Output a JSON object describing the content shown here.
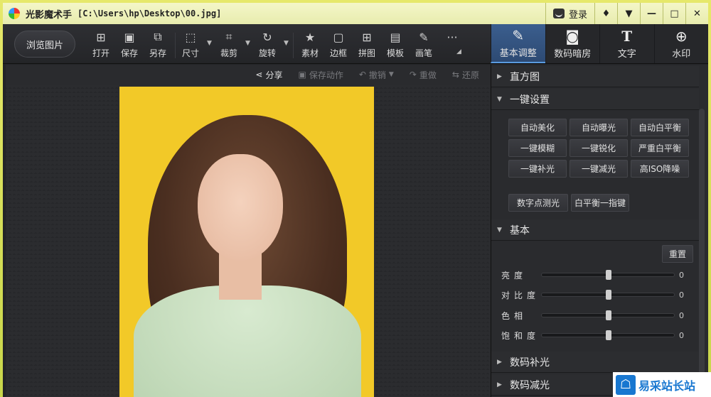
{
  "window": {
    "app_name": "光影魔术手",
    "file_path": "[C:\\Users\\hp\\Desktop\\00.jpg]",
    "login_label": "登录",
    "controls": [
      "♦",
      "▼",
      "—",
      "□",
      "✕"
    ]
  },
  "toolbar": {
    "browse_label": "浏览图片",
    "tools": [
      {
        "label": "打开",
        "icon": "open-icon"
      },
      {
        "label": "保存",
        "icon": "save-icon"
      },
      {
        "label": "另存",
        "icon": "save-as-icon"
      },
      {
        "label": "尺寸",
        "icon": "resize-icon"
      },
      {
        "label": "裁剪",
        "icon": "crop-icon"
      },
      {
        "label": "旋转",
        "icon": "rotate-icon"
      },
      {
        "label": "素材",
        "icon": "material-icon"
      },
      {
        "label": "边框",
        "icon": "border-icon"
      },
      {
        "label": "拼图",
        "icon": "collage-icon"
      },
      {
        "label": "模板",
        "icon": "template-icon"
      },
      {
        "label": "画笔",
        "icon": "brush-icon"
      },
      {
        "label": "···",
        "icon": "more-icon"
      }
    ]
  },
  "right_tabs": [
    {
      "label": "基本调整",
      "icon": "adjust-icon",
      "active": true
    },
    {
      "label": "数码暗房",
      "icon": "camera-icon",
      "active": false
    },
    {
      "label": "文字",
      "icon": "text-icon",
      "active": false
    },
    {
      "label": "水印",
      "icon": "watermark-icon",
      "active": false
    }
  ],
  "subbar": {
    "share": "分享",
    "save_action": "保存动作",
    "undo": "撤销",
    "redo": "重做",
    "restore": "还原"
  },
  "panel": {
    "histogram": "直方图",
    "one_click": "一键设置",
    "buttons": [
      "自动美化",
      "自动曝光",
      "自动白平衡",
      "一键模糊",
      "一键锐化",
      "严重白平衡",
      "一键补光",
      "一键减光",
      "高ISO降噪"
    ],
    "extra_buttons": [
      "数字点测光",
      "白平衡一指键"
    ],
    "basic": "基本",
    "reset": "重置",
    "sliders": [
      {
        "label": "亮度",
        "value": "0"
      },
      {
        "label": "对比度",
        "value": "0"
      },
      {
        "label": "色相",
        "value": "0"
      },
      {
        "label": "饱和度",
        "value": "0"
      }
    ],
    "digital_fill": "数码补光",
    "digital_reduce": "数码减光"
  },
  "watermark": {
    "text": "易采站长站"
  },
  "colors": {
    "active_tab": "#3b5e8e",
    "titlebar": "#e8ecae",
    "background": "#232427"
  }
}
